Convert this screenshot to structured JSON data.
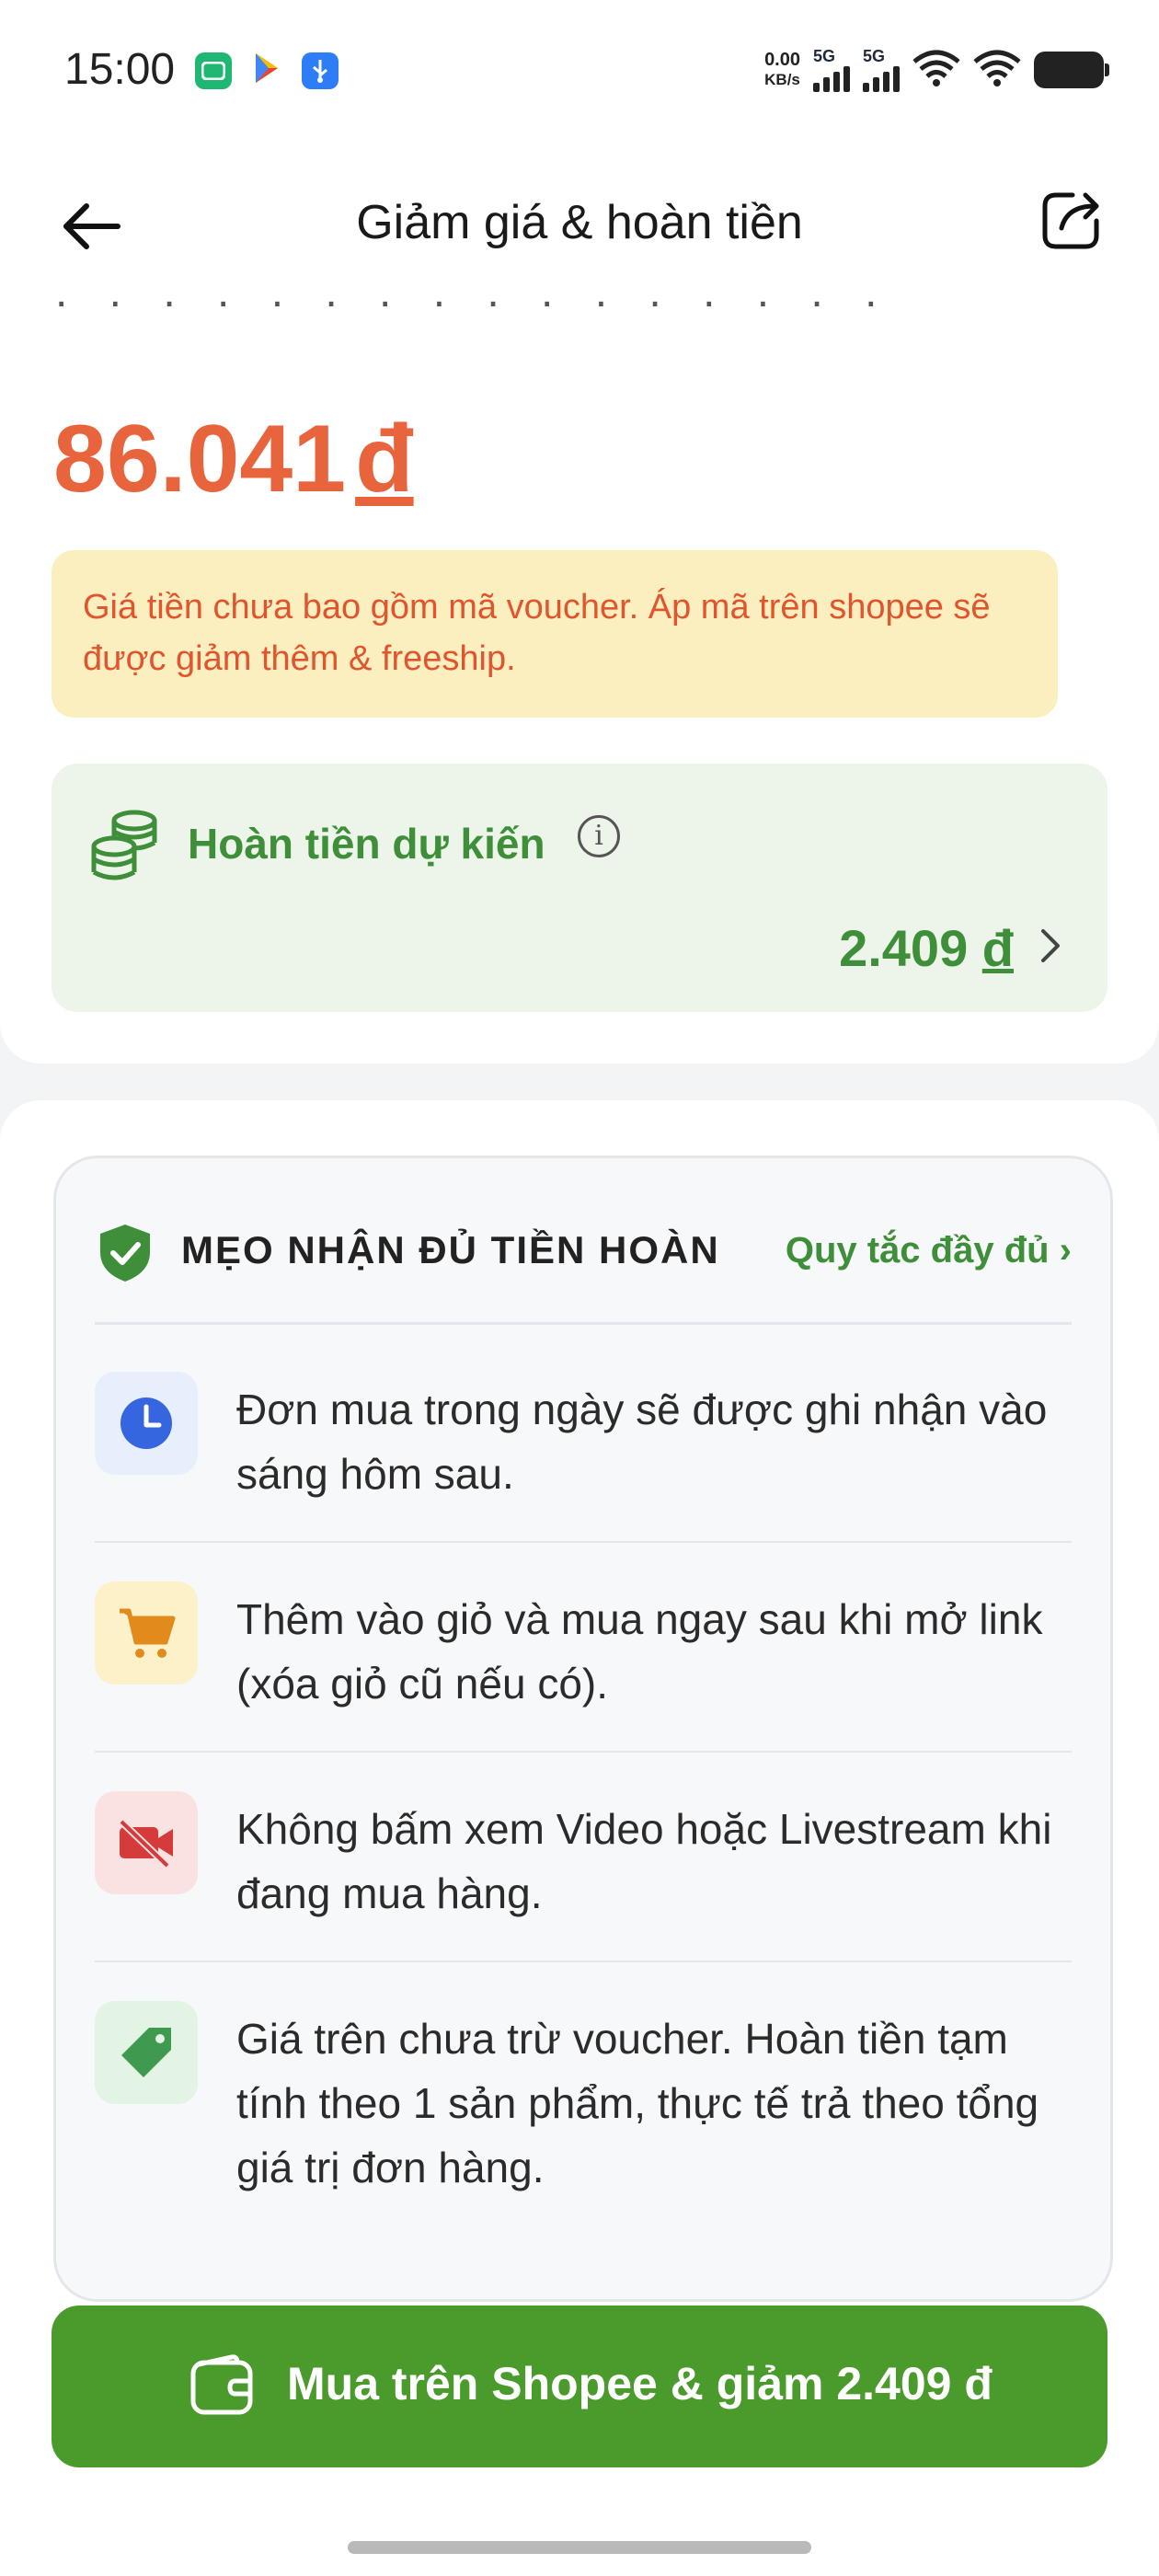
{
  "status_bar": {
    "time": "15:00",
    "net_speed_value": "0.00",
    "net_speed_unit": "KB/s",
    "signal_1_label": "5G",
    "signal_2_label": "5G"
  },
  "header": {
    "title": "Giảm giá & hoàn tiền"
  },
  "product": {
    "price_value": "86.041",
    "currency": "đ",
    "voucher_note": "Giá tiền chưa bao gồm mã voucher. Áp mã trên shopee sẽ được giảm thêm & freeship."
  },
  "refund": {
    "label": "Hoàn tiền dự kiến",
    "info_glyph": "i",
    "amount_value": "2.409",
    "currency": "đ"
  },
  "tips": {
    "title": "MẸO NHẬN ĐỦ TIỀN HOÀN",
    "rules_link": "Quy tắc đầy đủ ›",
    "items": [
      {
        "icon": "clock-icon",
        "text": "Đơn mua trong ngày sẽ được ghi nhận vào sáng hôm sau."
      },
      {
        "icon": "cart-icon",
        "text": "Thêm vào giỏ và mua ngay sau khi mở link (xóa giỏ cũ nếu có)."
      },
      {
        "icon": "video-off-icon",
        "text": "Không bấm xem Video hoặc Livestream khi đang mua hàng."
      },
      {
        "icon": "price-tag-icon",
        "text": "Giá trên chưa trừ voucher. Hoàn tiền tạm tính theo 1 sản phẩm, thực tế trả theo tổng giá trị đơn hàng."
      }
    ]
  },
  "cta": {
    "label": "Mua trên Shopee & giảm 2.409 đ"
  },
  "colors": {
    "accent_green": "#4a9a2c",
    "price_orange": "#e8643c",
    "note_bg": "#fbeebf"
  }
}
